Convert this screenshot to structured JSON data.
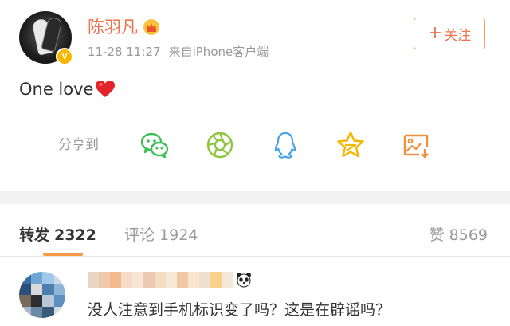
{
  "post": {
    "author": "陈羽凡",
    "timestamp": "11-28 11:27",
    "source": "来自iPhone客户端",
    "follow_label": "关注",
    "follow_plus": "+",
    "text": "One love",
    "share_label": "分享到",
    "share_targets": [
      "wechat-icon",
      "moments-icon",
      "qq-icon",
      "qzone-icon",
      "save-image-icon"
    ],
    "badges": [
      "verified-badge-icon",
      "crown-icon",
      "heart-emoji-icon"
    ]
  },
  "tabs": {
    "repost_label": "转发",
    "repost_count": "2322",
    "comment_label": "评论",
    "comment_count": "1924",
    "like_label": "赞",
    "like_count": "8569"
  },
  "comment": {
    "text": "没人注意到手机标识变了吗？这是在辟谣吗？",
    "name_emoji": "panda-emoji-icon"
  },
  "colors": {
    "accent": "#eb7350",
    "tab_underline": "#f59a45",
    "verified": "#f7b500",
    "wechat": "#3fbf5a",
    "moments": "#8cc63f",
    "qq": "#4aa3e8",
    "qzone": "#f7b500",
    "save": "#f0913b"
  }
}
